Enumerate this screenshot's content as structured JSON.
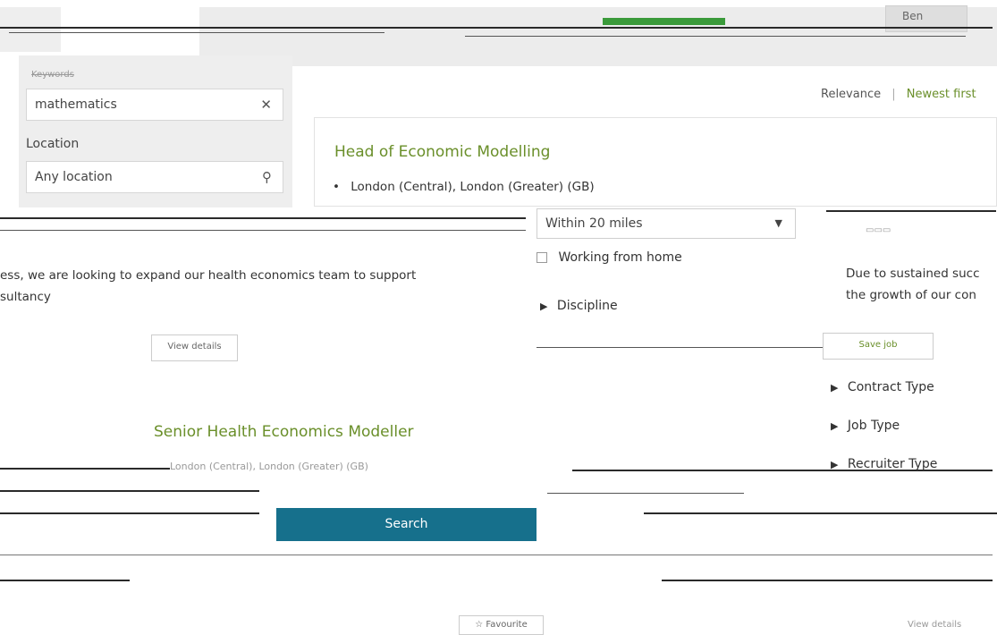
{
  "header": {
    "green_tab": "",
    "grey_button": "Ben"
  },
  "search_panel": {
    "keywords_label": "Keywords",
    "keywords_value": "mathematics",
    "location_label": "Location",
    "location_placeholder": "Any location"
  },
  "sort": {
    "relevance": "Relevance",
    "separator": "|",
    "newest": "Newest first"
  },
  "job1": {
    "title": "Head of Economic Modelling",
    "location": "London (Central), London (Greater) (GB)",
    "description_line1": "Due to sustained succ",
    "description_line2": "the growth of our con",
    "description_left1": "ess, we are looking to expand our health economics team to support",
    "description_left2": "sultancy",
    "view_details": "View details",
    "save_job": "Save job"
  },
  "filters": {
    "distance_value": "Within 20 miles",
    "working_from_home": "Working from home",
    "discipline": "Discipline",
    "contract_type": "Contract Type",
    "job_type": "Job Type",
    "recruiter_type": "Recruiter Type"
  },
  "job2": {
    "title": "Senior Health Economics Modeller",
    "location": "London (Central), London (Greater) (GB)",
    "favourite": "Favourite",
    "view_details": "View details"
  },
  "search_button": "Search",
  "icons": {
    "clear": "close-icon",
    "location": "map-pin-icon",
    "dropdown": "chevron-down-icon",
    "expand": "triangle-right-icon"
  }
}
